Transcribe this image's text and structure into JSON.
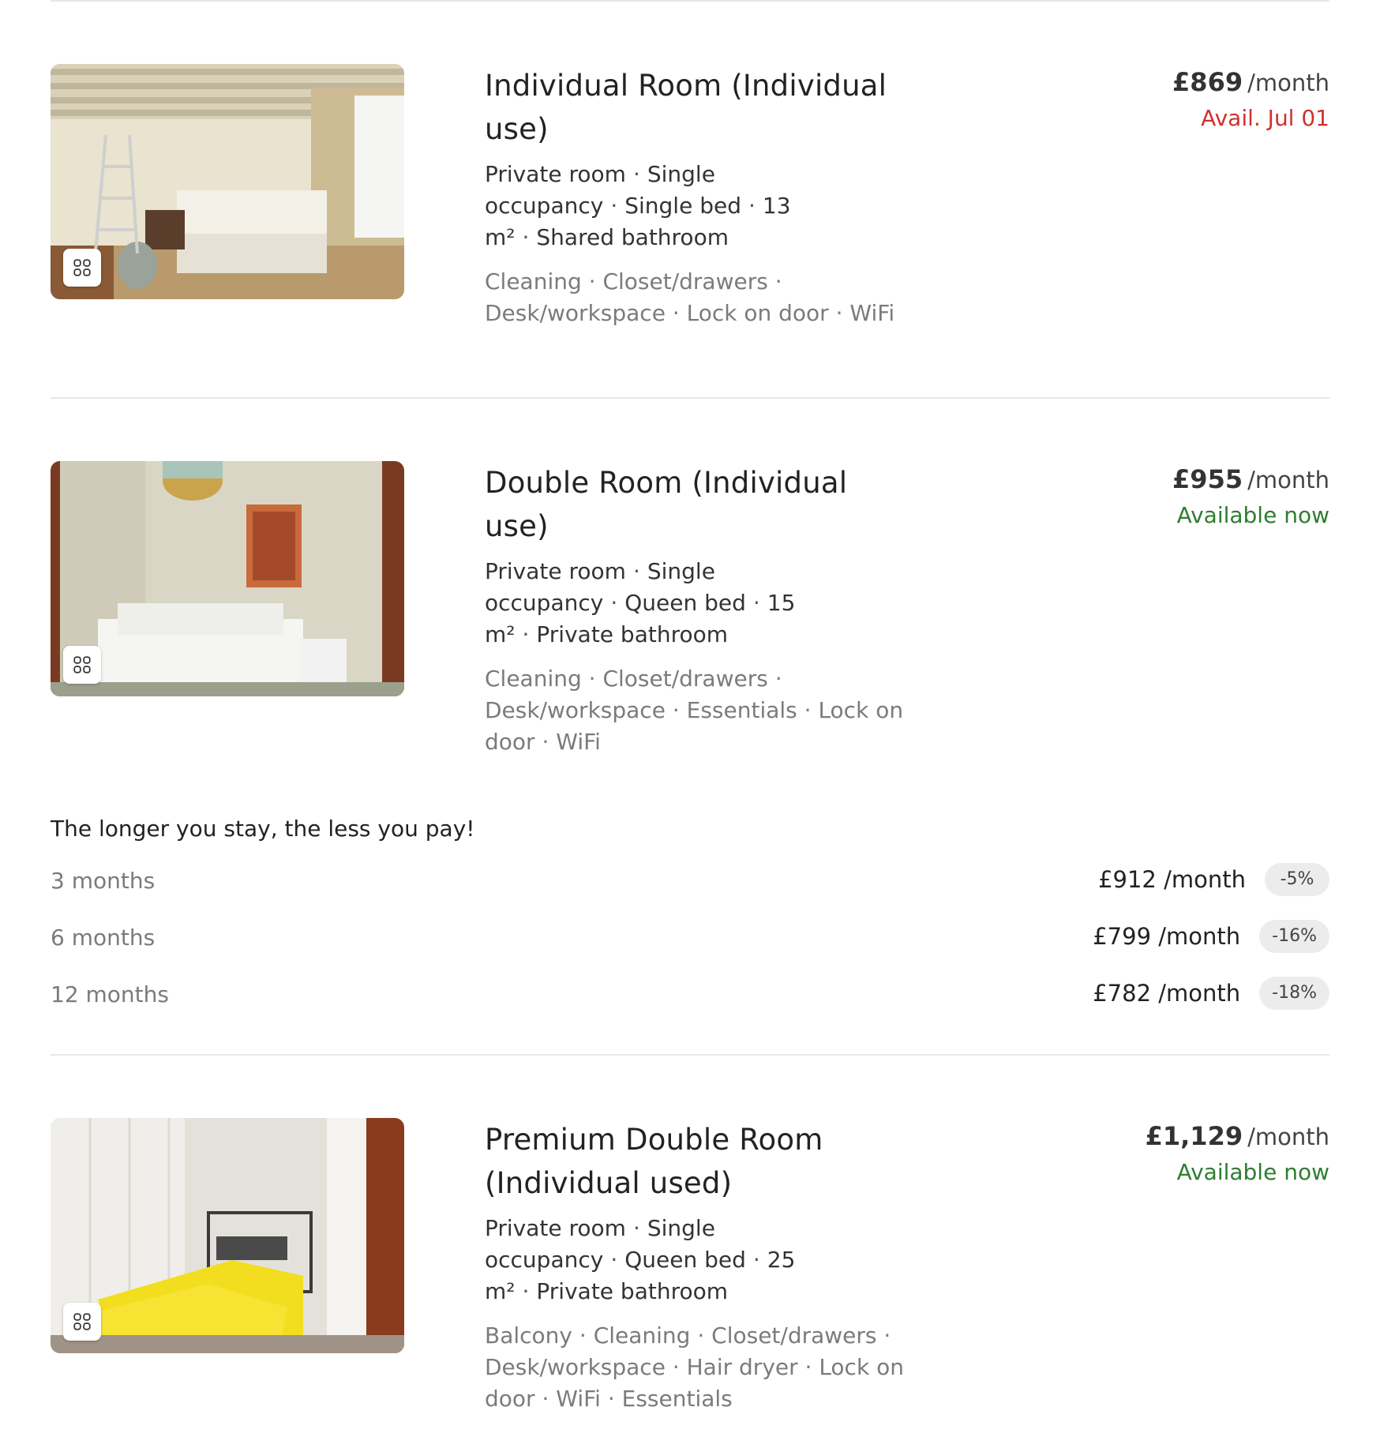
{
  "listings": [
    {
      "title": "Individual Room (Individual use)",
      "specs": [
        "Private room",
        "Single occupancy",
        "Single bed",
        "13 m²",
        "Shared bathroom"
      ],
      "amenities": "Cleaning · Closet/drawers · Desk/workspace · Lock on door · WiFi",
      "price": "£869",
      "price_unit": "/month",
      "availability": "Avail. Jul 01",
      "availability_color": "#d0312d",
      "photo_icon": "gallery-grid-icon"
    },
    {
      "title": "Double Room (Individual use)",
      "specs": [
        "Private room",
        "Single occupancy",
        "Queen bed",
        "15 m²",
        "Private bathroom"
      ],
      "amenities": "Cleaning · Closet/drawers · Desk/workspace · Essentials · Lock on door · WiFi",
      "price": "£955",
      "price_unit": "/month",
      "availability": "Available now",
      "availability_color": "#2e7d32",
      "photo_icon": "gallery-grid-icon"
    },
    {
      "title": "Premium Double Room (Individual used)",
      "specs": [
        "Private room",
        "Single occupancy",
        "Queen bed",
        "25 m²",
        "Private bathroom"
      ],
      "amenities": "Balcony · Cleaning · Closet/drawers · Desk/workspace · Hair dryer · Lock on door · WiFi · Essentials",
      "price": "£1,129",
      "price_unit": "/month",
      "availability": "Available now",
      "availability_color": "#2e7d32",
      "photo_icon": "gallery-grid-icon"
    }
  ],
  "discounts": {
    "title": "The longer you stay, the less you pay!",
    "rows": [
      {
        "duration": "3 months",
        "price": "£912 /month",
        "badge": "-5%"
      },
      {
        "duration": "6 months",
        "price": "£799 /month",
        "badge": "-16%"
      },
      {
        "duration": "12 months",
        "price": "£782 /month",
        "badge": "-18%"
      }
    ]
  }
}
